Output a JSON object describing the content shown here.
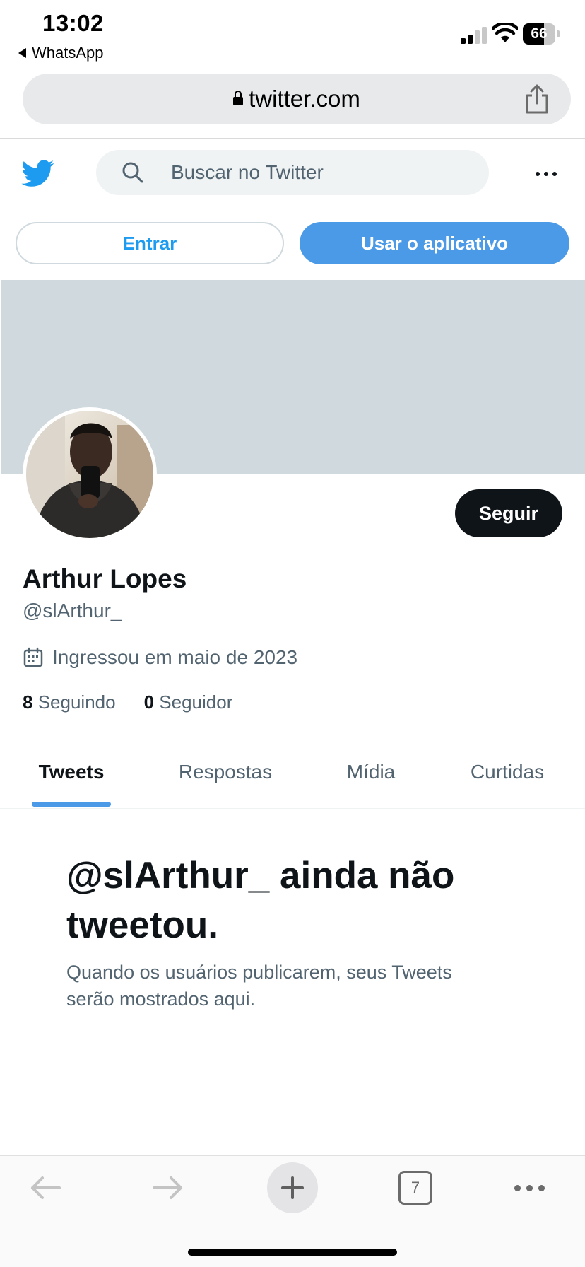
{
  "status_bar": {
    "time": "13:02",
    "back_app": "WhatsApp",
    "battery": "66",
    "battery_level": 0.66
  },
  "browser": {
    "url": "twitter.com",
    "tabs_count": "7"
  },
  "header": {
    "search_placeholder": "Buscar no Twitter",
    "login_label": "Entrar",
    "use_app_label": "Usar o aplicativo"
  },
  "profile": {
    "name": "Arthur Lopes",
    "handle": "@slArthur_",
    "joined": "Ingressou em maio de 2023",
    "following_count": "8",
    "following_label": "Seguindo",
    "followers_count": "0",
    "followers_label": "Seguidor",
    "follow_button": "Seguir"
  },
  "tabs": [
    {
      "label": "Tweets",
      "active": true
    },
    {
      "label": "Respostas",
      "active": false
    },
    {
      "label": "Mídia",
      "active": false
    },
    {
      "label": "Curtidas",
      "active": false
    }
  ],
  "empty_state": {
    "title": "@slArthur_ ainda não tweetou.",
    "subtitle": "Quando os usuários publicarem, seus Tweets serão mostrados aqui."
  },
  "colors": {
    "twitter_blue": "#1d9bf0",
    "app_button": "#4a9ae8",
    "banner": "#cfd9de",
    "follow_button": "#0f1419"
  },
  "icons": {
    "bird": "twitter-bird-icon",
    "search": "search-icon",
    "more": "more-horizontal-icon",
    "calendar": "calendar-icon",
    "lock": "lock-icon",
    "share": "share-icon",
    "back": "arrow-left-icon",
    "forward": "arrow-right-icon",
    "new_tab": "plus-icon",
    "menu": "more-horizontal-icon"
  }
}
